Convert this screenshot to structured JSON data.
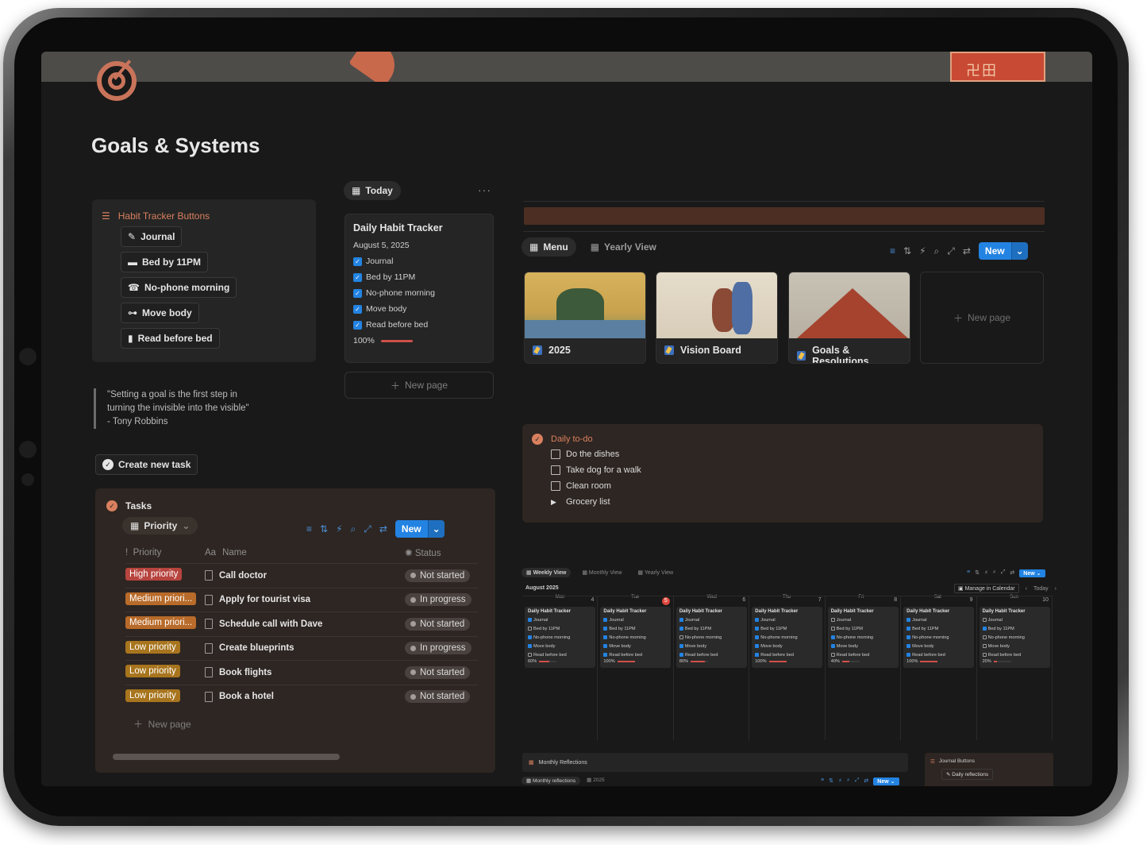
{
  "page": {
    "title": "Goals & Systems",
    "cover_stamp": "卍田"
  },
  "habit_buttons": {
    "heading": "Habit Tracker Buttons",
    "buttons": [
      "Journal",
      "Bed by 11PM",
      "No-phone morning",
      "Move body",
      "Read before bed"
    ]
  },
  "quote": {
    "line1": "\"Setting a goal is the first step in",
    "line2": "turning the invisible into the visible\"",
    "author": "- Tony Robbins"
  },
  "create_task_label": "Create new task",
  "tasks": {
    "title": "Tasks",
    "view_label": "Priority",
    "new_label": "New",
    "columns": {
      "priority": "Priority",
      "name": "Name",
      "status": "Status"
    },
    "rows": [
      {
        "priority": "High priority",
        "name": "Call doctor",
        "status": "Not started"
      },
      {
        "priority": "Medium priori...",
        "name": "Apply for tourist visa",
        "status": "In progress"
      },
      {
        "priority": "Medium priori...",
        "name": "Schedule call with Dave",
        "status": "Not started"
      },
      {
        "priority": "Low priority",
        "name": "Create blueprints",
        "status": "In progress"
      },
      {
        "priority": "Low priority",
        "name": "Book flights",
        "status": "Not started"
      },
      {
        "priority": "Low priority",
        "name": "Book a hotel",
        "status": "Not started"
      }
    ],
    "new_page": "New page",
    "colors": {
      "high": "#b7443e",
      "medium": "#b86b2a",
      "low": "#a8751e"
    }
  },
  "today": {
    "tab_label": "Today",
    "card": {
      "title": "Daily Habit Tracker",
      "date": "August 5, 2025",
      "items": [
        "Journal",
        "Bed by 11PM",
        "No-phone morning",
        "Move body",
        "Read before bed"
      ],
      "progress_text": "100%",
      "progress": 1.0
    },
    "new_page": "New page"
  },
  "menu": {
    "tabs": [
      "Menu",
      "Yearly View"
    ],
    "new_label": "New",
    "cards": [
      "2025",
      "Vision Board",
      "Goals & Resolutions"
    ],
    "new_page": "New page"
  },
  "todo": {
    "heading": "Daily to-do",
    "items": [
      "Do the dishes",
      "Take dog for a walk",
      "Clean room"
    ],
    "toggle": "Grocery list"
  },
  "calendar": {
    "tabs": [
      "Weekly View",
      "Monthly View",
      "Yearly View"
    ],
    "new_label": "New",
    "month": "August 2025",
    "manage": "Manage in Calendar",
    "today": "Today",
    "weekdays": [
      "Mon",
      "Tue",
      "Wed",
      "Thu",
      "Fri",
      "Sat",
      "Sun"
    ],
    "days": [
      {
        "num": "4",
        "checks": [
          1,
          0,
          1,
          1,
          0
        ],
        "pct": "60%",
        "p": 0.6
      },
      {
        "num": "5",
        "checks": [
          1,
          1,
          1,
          1,
          1
        ],
        "pct": "100%",
        "p": 1.0,
        "today": true
      },
      {
        "num": "6",
        "checks": [
          1,
          1,
          0,
          1,
          1
        ],
        "pct": "80%",
        "p": 0.8
      },
      {
        "num": "7",
        "checks": [
          1,
          1,
          1,
          1,
          1
        ],
        "pct": "100%",
        "p": 1.0
      },
      {
        "num": "8",
        "checks": [
          0,
          0,
          1,
          1,
          0
        ],
        "pct": "40%",
        "p": 0.4
      },
      {
        "num": "9",
        "checks": [
          1,
          1,
          1,
          1,
          1
        ],
        "pct": "100%",
        "p": 1.0
      },
      {
        "num": "10",
        "checks": [
          0,
          1,
          0,
          0,
          0
        ],
        "pct": "20%",
        "p": 0.2
      }
    ],
    "card_title": "Daily Habit Tracker",
    "item_names": [
      "Journal",
      "Bed by 11PM",
      "No-phone morning",
      "Move body",
      "Read before bed"
    ]
  },
  "reflections": {
    "title": "Monthly Reflections",
    "tabs": [
      "Monthly reflections",
      "2025"
    ],
    "new_label": "New"
  },
  "journal_buttons": {
    "heading": "Journal Buttons",
    "button": "Daily reflections"
  }
}
